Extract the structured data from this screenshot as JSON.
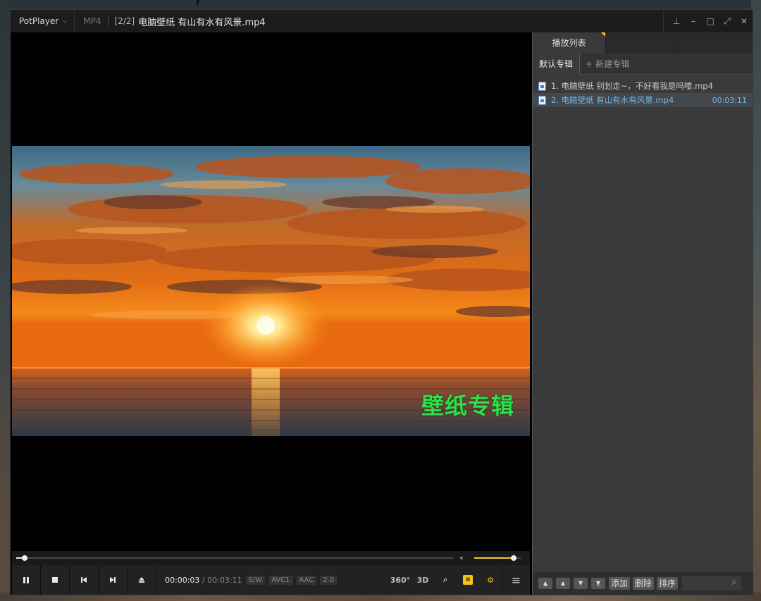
{
  "titlebar": {
    "app_name": "PotPlayer",
    "app_chevron": "⌵",
    "format": "MP4",
    "index": "[2/2]",
    "file_title": "电脑壁纸 有山有水有风景.mp4"
  },
  "window_controls": {
    "pin": "⊥",
    "minimize": "–",
    "maximize": "□",
    "fullscreen": "⤢",
    "close": "✕"
  },
  "video": {
    "overlay_text": "壁纸专辑"
  },
  "seek": {
    "progress": 0.016,
    "volume": 0.85
  },
  "controls": {
    "current_time": "00:00:03",
    "separator": "/",
    "total_time": "00:03:11",
    "badges": [
      "S/W",
      "AVC1",
      "AAC",
      "2.0"
    ],
    "tool_360": "360°",
    "tool_3d": "3D"
  },
  "panel": {
    "tab_playlist": "播放列表",
    "album_default": "默认专辑",
    "album_new": "新建专辑",
    "album_new_prefix": "+",
    "items": [
      {
        "name": "1. 电脑壁纸  别划走~，不好看我是吗喽.mp4",
        "duration": ""
      },
      {
        "name": "2. 电脑壁纸 有山有水有风景.mp4",
        "duration": "00:03:11"
      }
    ],
    "btn_add": "添加",
    "btn_delete": "删除",
    "btn_sort": "排序"
  },
  "colors": {
    "accent": "#f5c518",
    "overlay_green": "#2ee04a",
    "active_item": "#6fb7e8"
  }
}
